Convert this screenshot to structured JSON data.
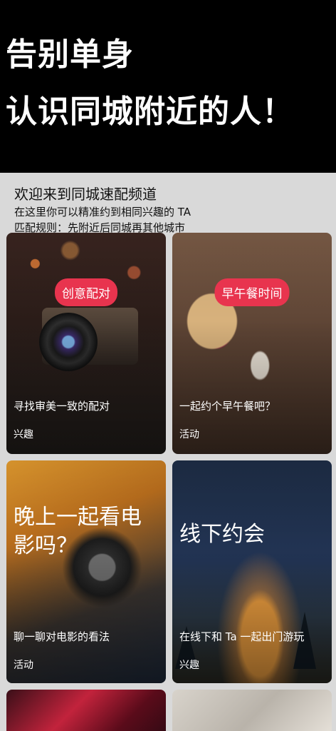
{
  "hero": {
    "line1": "告别单身",
    "line2": "认识同城附近的人！"
  },
  "intro": {
    "title": "欢迎来到同城速配频道",
    "line1": "在这里你可以精准约到相同兴趣的 TA",
    "line2": "匹配规则：先附近后同城再其他城市"
  },
  "cards": [
    {
      "pill": "创意配对",
      "desc": "寻找审美一致的配对",
      "tag": "兴趣"
    },
    {
      "pill": "早午餐时间",
      "desc": "一起约个早午餐吧？",
      "tag": "活动"
    },
    {
      "title": "晚上一起看电影吗？",
      "desc": "聊一聊对电影的看法",
      "tag": "活动"
    },
    {
      "title": "线下约会",
      "desc": "在线下和 Ta 一起出门游玩",
      "tag": "兴趣"
    }
  ],
  "colors": {
    "accent": "#e8344e",
    "panel_bg": "#d9d9d9",
    "hero_bg": "#000000"
  }
}
